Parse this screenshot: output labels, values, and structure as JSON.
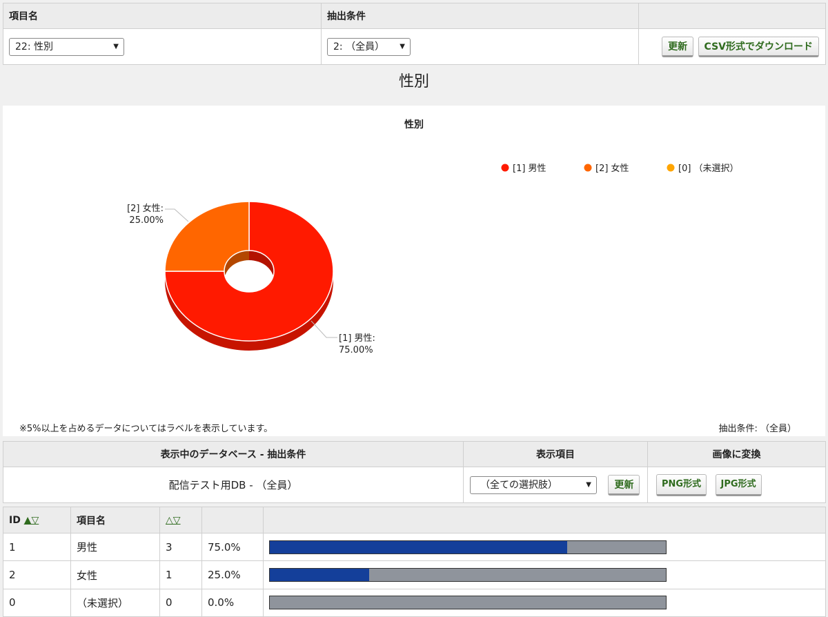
{
  "filter_bar": {
    "item_header": "項目名",
    "cond_header": "抽出条件",
    "item_select": "22: 性別",
    "cond_select": "2: （全員）",
    "update_label": "更新",
    "csv_label": "CSV形式でダウンロード"
  },
  "page_title": "性別",
  "chart_data": {
    "type": "pie",
    "title": "性別",
    "categories": [
      "[1] 男性",
      "[2] 女性",
      "[0] （未選択）"
    ],
    "values": [
      75.0,
      25.0,
      0.0
    ],
    "slice_labels": [
      {
        "name": "[1] 男性:",
        "pct": "75.00%"
      },
      {
        "name": "[2] 女性:",
        "pct": "25.00%"
      }
    ],
    "colors": [
      "#ff1a00",
      "#ff6600",
      "#ffa500"
    ],
    "legend_position": "top-right",
    "donut": true
  },
  "chart_note": "※5%以上を占めるデータについてはラベルを表示しています。",
  "chart_filter": "抽出条件: （全員）",
  "info": {
    "db_header": "表示中のデータベース - 抽出条件",
    "display_header": "表示項目",
    "convert_header": "画像に変換",
    "db_value": "配信テスト用DB - （全員）",
    "display_select": "（全ての選択肢）",
    "update_label": "更新",
    "png_label": "PNG形式",
    "jpg_label": "JPG形式"
  },
  "table": {
    "id_header": "ID",
    "id_sort": "▲▽",
    "name_header": "項目名",
    "count_sort": "△▽",
    "rows": [
      {
        "id": "1",
        "name": "男性",
        "count": "3",
        "pct": "75.0%",
        "share": 0.75
      },
      {
        "id": "2",
        "name": "女性",
        "count": "1",
        "pct": "25.0%",
        "share": 0.25
      },
      {
        "id": "0",
        "name": "（未選択）",
        "count": "0",
        "pct": "0.0%",
        "share": 0.0
      }
    ]
  }
}
